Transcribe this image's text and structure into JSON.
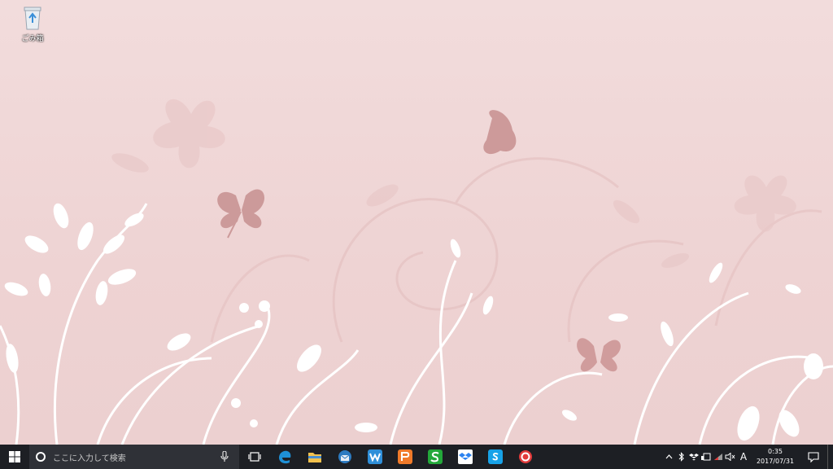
{
  "desktop": {
    "icons": [
      {
        "label": "ごみ箱",
        "icon": "recycle-bin-icon"
      }
    ],
    "wallpaper": {
      "description_colors": {
        "background": "#efd6d6",
        "flourish": "#ffffff",
        "butterfly": "#c99090",
        "shadow_flourish": "#e5c2c2"
      }
    }
  },
  "taskbar": {
    "start_icon": "windows-logo-icon",
    "search": {
      "placeholder": "ここに入力して検索",
      "icon": "cortana-icon",
      "mic_icon": "microphone-icon"
    },
    "pinned": [
      {
        "name": "task-view",
        "icon": "task-view-icon"
      },
      {
        "name": "edge",
        "icon": "edge-icon",
        "color": "#1e90d6"
      },
      {
        "name": "file-explorer",
        "icon": "folder-icon",
        "color": "#f2c14e"
      },
      {
        "name": "thunderbird",
        "icon": "thunderbird-icon",
        "color": "#2d7bc1"
      },
      {
        "name": "wps-writer",
        "icon": "wps-writer-icon",
        "color": "#2f8fd9"
      },
      {
        "name": "wps-presentation",
        "icon": "wps-presentation-icon",
        "color": "#f07a2a"
      },
      {
        "name": "wps-spreadsheets",
        "icon": "wps-spreadsheets-icon",
        "color": "#23a83a"
      },
      {
        "name": "dropbox",
        "icon": "dropbox-icon",
        "color": "#2b82f0"
      },
      {
        "name": "skype",
        "icon": "skype-icon",
        "color": "#17a2e8"
      },
      {
        "name": "app-red",
        "icon": "red-circle-app-icon",
        "color": "#e23b3b"
      }
    ],
    "tray": {
      "icons": [
        "chevron-up-icon",
        "bluetooth-icon",
        "dropbox-tray-icon",
        "battery-icon",
        "network-icon",
        "volume-muted-icon"
      ],
      "ime": "A",
      "time": "0:35",
      "date": "2017/07/31",
      "notification_icon": "action-center-icon"
    }
  }
}
